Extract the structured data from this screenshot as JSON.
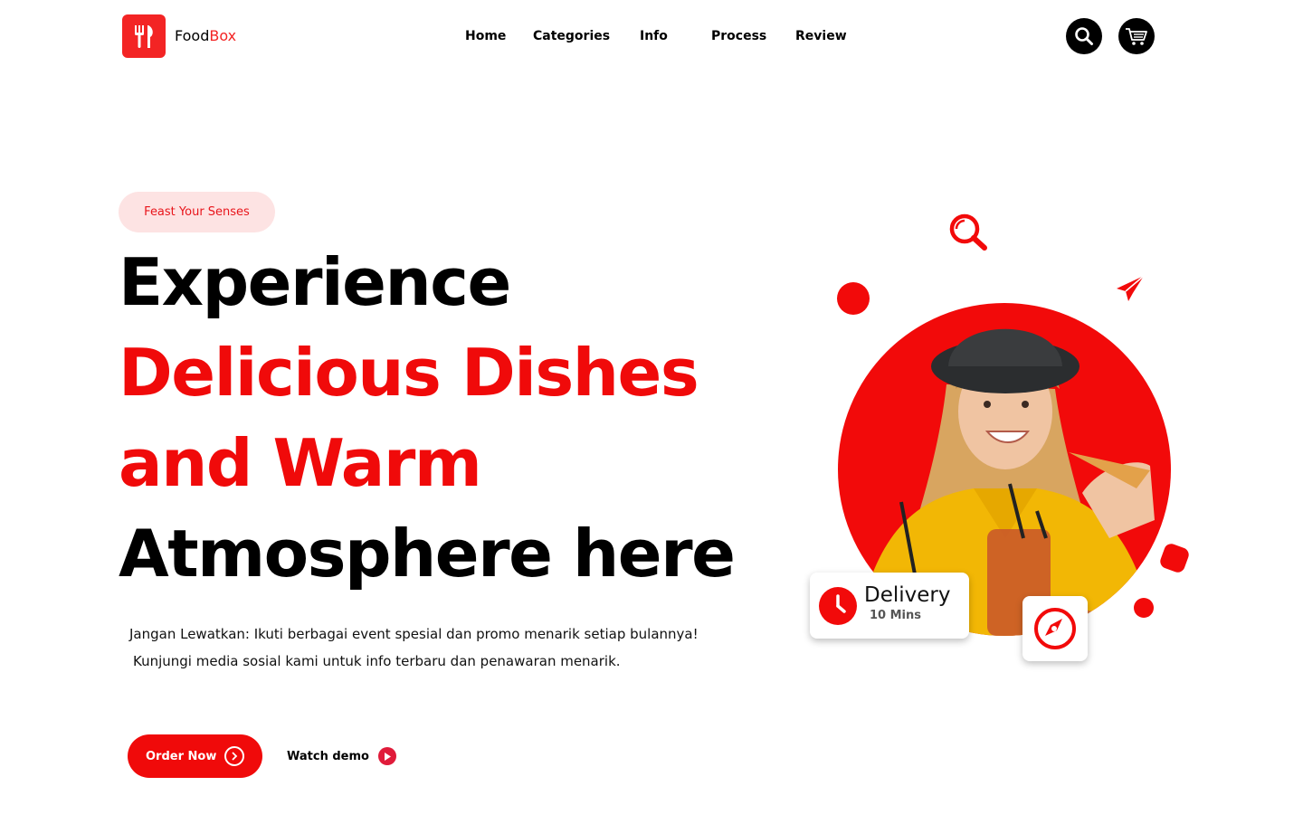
{
  "brand": {
    "name_part1": "Food",
    "name_part2": "Box",
    "accent_color": "#f32424",
    "logo_icon": "fork-knife-icon"
  },
  "nav": {
    "items": [
      "Home",
      "Categories",
      "Info",
      "Process",
      "Review"
    ]
  },
  "header_actions": {
    "search_icon": "search-icon",
    "cart_icon": "cart-icon"
  },
  "hero": {
    "badge": "Feast Your Senses",
    "headline_lines": [
      "Experience",
      "Delicious Dishes",
      "and Warm",
      "Atmosphere here"
    ],
    "description_line1": "Jangan Lewatkan: Ikuti berbagai event spesial dan promo menarik setiap bulannya!",
    "description_line2": "Kunjungi media sosial kami untuk info terbaru dan penawaran menarik.",
    "order_button": "Order Now",
    "watch_demo": "Watch demo"
  },
  "delivery_card": {
    "title": "Delivery",
    "subtitle": "10 Mins"
  },
  "colors": {
    "red": "#f00a0a",
    "badge_bg": "#fde3e3",
    "black": "#000000",
    "photo_shirt": "#f2b705"
  }
}
